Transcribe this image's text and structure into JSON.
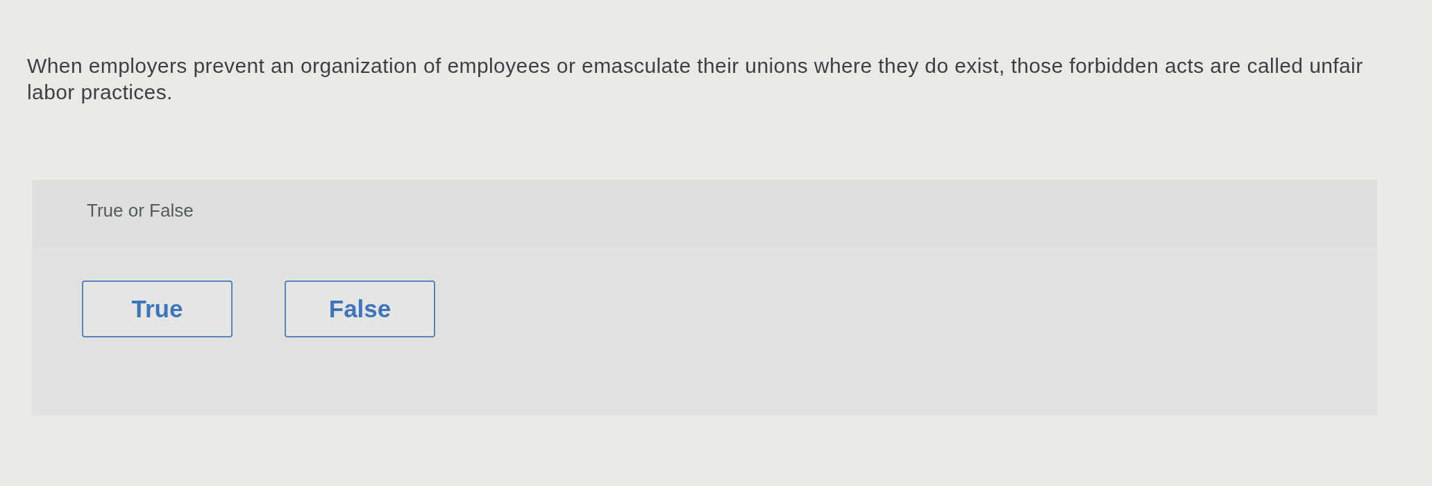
{
  "question": {
    "text": "When employers prevent an organization of employees or emasculate their unions where they do exist, those forbidden acts are called unfair labor practices."
  },
  "answer_panel": {
    "label": "True or False",
    "options": [
      {
        "label": "True",
        "selected": false
      },
      {
        "label": "False",
        "selected": false
      }
    ]
  }
}
